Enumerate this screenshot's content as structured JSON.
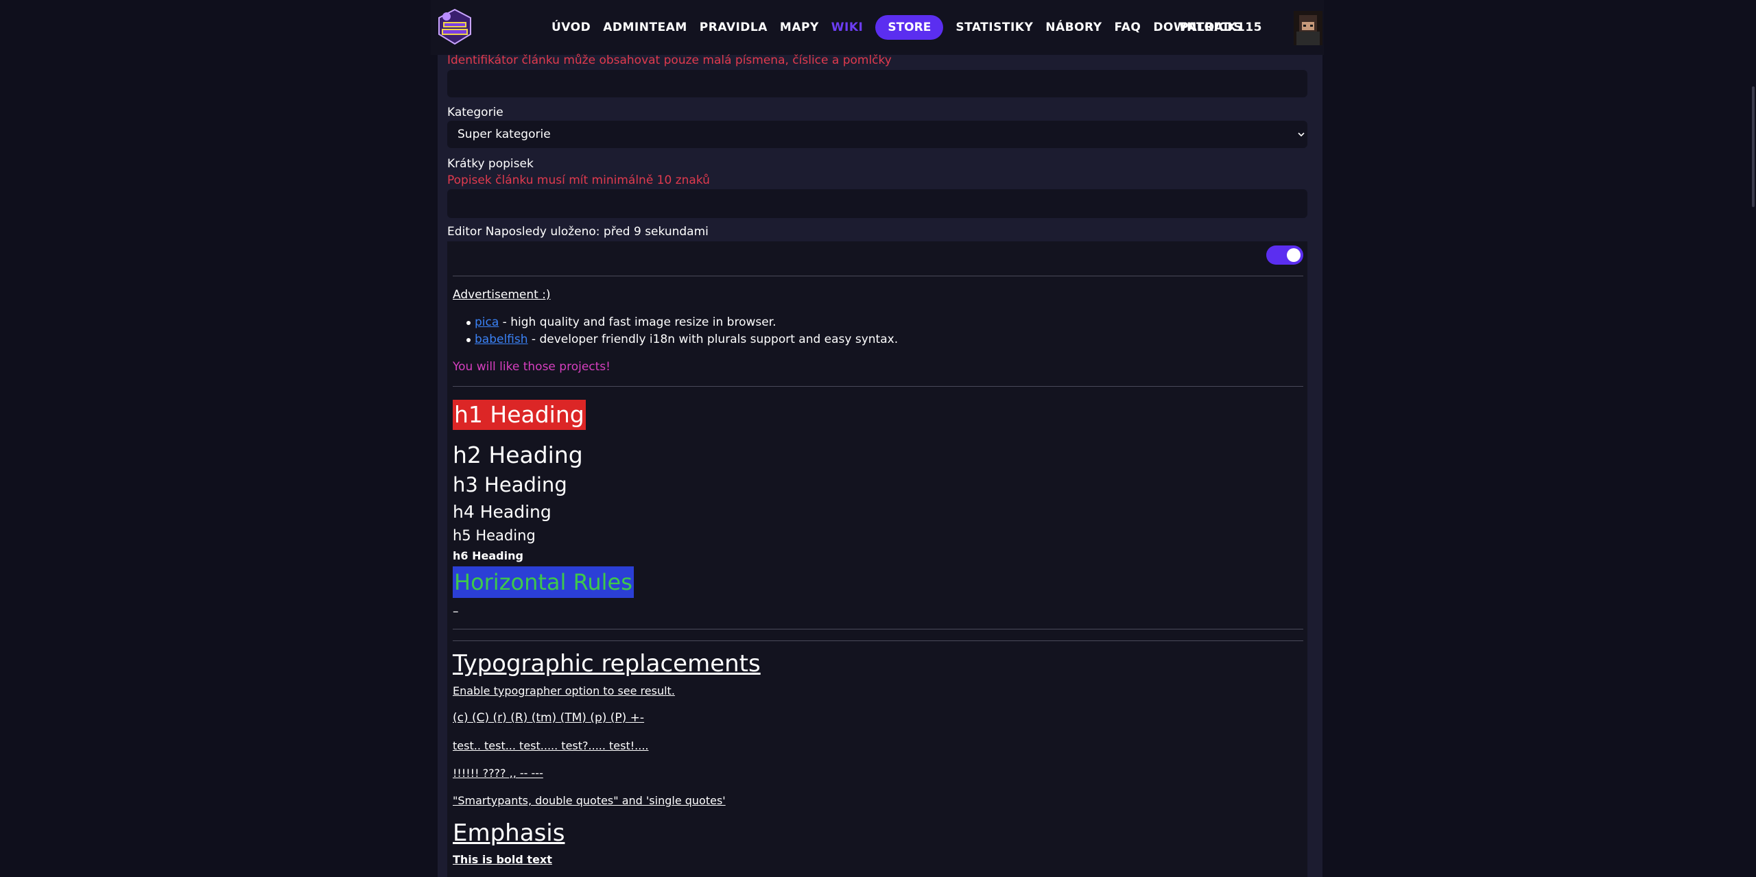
{
  "nav": {
    "links": [
      "ÚVOD",
      "ADMINTEAM",
      "PRAVIDLA",
      "MAPY",
      "WIKI"
    ],
    "store": "STORE",
    "links_right": [
      "STATISTIKY",
      "NÁBORY",
      "FAQ",
      "DOWNLOADS"
    ],
    "username": "PATRICK115",
    "active": "WIKI",
    "colors": {
      "accent": "#5b2ef0",
      "active_link": "#6d3df5"
    }
  },
  "form": {
    "slug_error": "Identifikátor článku může obsahovat pouze malá písmena, číslice a pomlčky",
    "category_label": "Kategorie",
    "category_value": "Super kategorie",
    "description_label": "Krátky popisek",
    "description_error": "Popisek článku musí mít minimálně 10 znaků",
    "editor_label": "Editor Naposledy uloženo: před 9 sekundami"
  },
  "editor": {
    "toggle_on": true,
    "ad_title": "Advertisement :)",
    "ad_items": [
      {
        "link": "pica",
        "text": " - high quality and fast image resize in browser."
      },
      {
        "link": "babelfish",
        "text": " - developer friendly i18n with plurals support and easy syntax."
      }
    ],
    "ad_footer": "You will like those projects!",
    "h1": "h1 Heading",
    "h2": "h2 Heading",
    "h3": "h3 Heading",
    "h4": "h4 Heading",
    "h5": "h5 Heading",
    "h6": "h6 Heading",
    "hr_heading": "Horizontal Rules",
    "dash": "–",
    "typo_heading": "Typographic replacements",
    "typo_lines": [
      "Enable typographer option to see result.",
      "(c) (C) (r) (R) (tm) (TM) (p) (P) +-",
      "test.. test... test..... test?..... test!....",
      "!!!!!! ???? ,, -- ---",
      "\"Smartypants, double quotes\" and 'single quotes'"
    ],
    "emphasis_heading": "Emphasis",
    "bold_text": "This is bold text"
  }
}
